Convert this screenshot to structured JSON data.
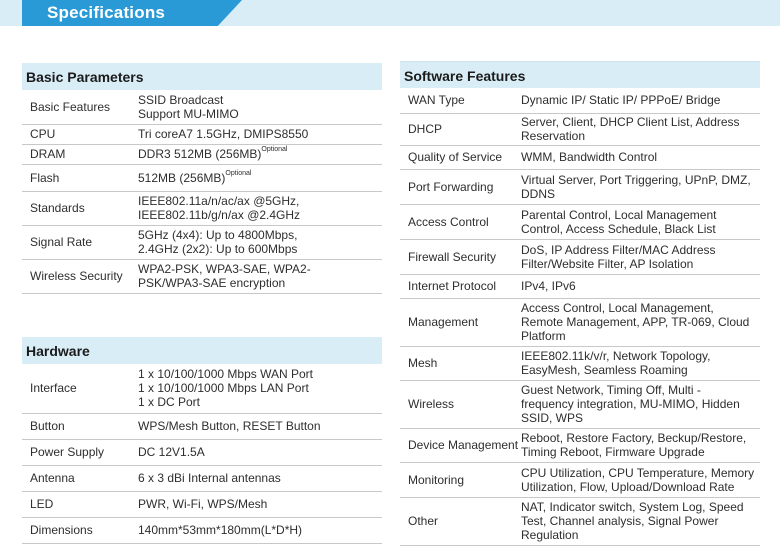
{
  "title": "Specifications",
  "basic": {
    "heading": "Basic Parameters",
    "rows": [
      {
        "k": "Basic Features",
        "v": [
          "SSID Broadcast",
          "Support MU-MIMO"
        ]
      },
      {
        "k": "CPU",
        "v": [
          "Tri coreA7 1.5GHz, DMIPS8550"
        ]
      },
      {
        "k": "DRAM",
        "v": [
          "DDR3 512MB (256MB)"
        ],
        "sup": "Optional"
      },
      {
        "k": "Flash",
        "v": [
          "512MB (256MB)"
        ],
        "sup": "Optional"
      },
      {
        "k": "Standards",
        "v": [
          "IEEE802.11a/n/ac/ax @5GHz,",
          "IEEE802.11b/g/n/ax @2.4GHz"
        ]
      },
      {
        "k": "Signal Rate",
        "v": [
          "5GHz (4x4): Up to 4800Mbps,",
          "2.4GHz (2x2): Up to 600Mbps"
        ]
      },
      {
        "k": "Wireless Security",
        "v": [
          "WPA2-PSK, WPA3-SAE, WPA2-",
          "PSK/WPA3-SAE encryption"
        ]
      }
    ]
  },
  "hardware": {
    "heading": "Hardware",
    "rows": [
      {
        "k": "Interface",
        "v": [
          "1 x 10/100/1000 Mbps WAN Port",
          "1 x 10/100/1000 Mbps LAN Port",
          "1 x DC Port"
        ]
      },
      {
        "k": "Button",
        "v": [
          "WPS/Mesh Button, RESET Button"
        ]
      },
      {
        "k": "Power Supply",
        "v": [
          "DC 12V1.5A"
        ]
      },
      {
        "k": "Antenna",
        "v": [
          "6 x 3 dBi Internal antennas"
        ]
      },
      {
        "k": "LED",
        "v": [
          "PWR, Wi-Fi, WPS/Mesh"
        ]
      },
      {
        "k": "Dimensions",
        "v": [
          "140mm*53mm*180mm(L*D*H)"
        ]
      }
    ]
  },
  "software": {
    "heading": "Software Features",
    "rows": [
      {
        "k": "WAN Type",
        "v": [
          "Dynamic IP/ Static IP/ PPPoE/ Bridge"
        ]
      },
      {
        "k": "DHCP",
        "v": [
          "Server, Client, DHCP Client List, Address",
          "Reservation"
        ]
      },
      {
        "k": "Quality of Service",
        "v": [
          "WMM, Bandwidth Control"
        ]
      },
      {
        "k": "Port Forwarding",
        "v": [
          "Virtual Server, Port Triggering, UPnP, DMZ,",
          "DDNS"
        ]
      },
      {
        "k": "Access Control",
        "v": [
          "Parental Control, Local Management",
          "Control, Access Schedule, Black List"
        ]
      },
      {
        "k": "Firewall Security",
        "v": [
          "DoS, IP Address Filter/MAC Address",
          "Filter/Website Filter, AP Isolation"
        ]
      },
      {
        "k": "Internet Protocol",
        "v": [
          "IPv4, IPv6"
        ]
      },
      {
        "k": "Management",
        "v": [
          "Access Control, Local Management,",
          "Remote Management, APP, TR-069, Cloud",
          "Platform"
        ]
      },
      {
        "k": "Mesh",
        "v": [
          "IEEE802.11k/v/r, Network Topology,",
          "EasyMesh, Seamless Roaming"
        ]
      },
      {
        "k": "Wireless",
        "v": [
          "Guest Network, Timing Off, Multi -",
          "frequency integration, MU-MIMO, Hidden",
          "SSID, WPS"
        ]
      },
      {
        "k": "Device Management",
        "v": [
          "Reboot, Restore Factory, Beckup/Restore,",
          "Timing Reboot, Firmware Upgrade"
        ]
      },
      {
        "k": "Monitoring",
        "v": [
          "CPU Utilization, CPU Temperature, Memory",
          "Utilization, Flow, Upload/Download Rate"
        ]
      },
      {
        "k": "Other",
        "v": [
          "NAT, Indicator switch, System Log, Speed",
          "Test, Channel analysis, Signal Power",
          "Regulation"
        ]
      }
    ]
  }
}
